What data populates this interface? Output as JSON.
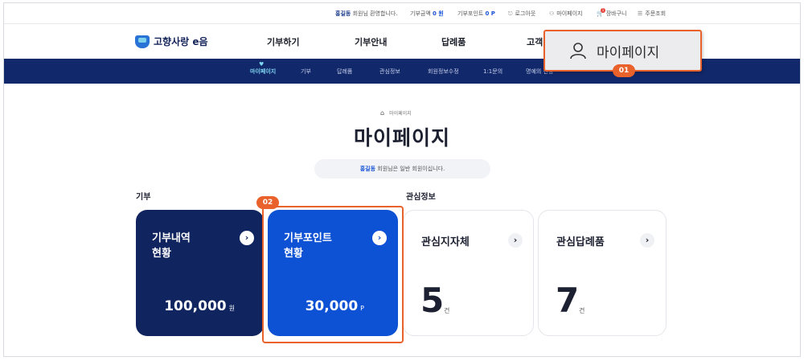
{
  "utility": {
    "user_name": "홍길동",
    "welcome": "회원님 환영합니다.",
    "donation_label": "기부금액",
    "donation_value": "0 원",
    "point_label": "기부포인트",
    "point_value": "0 P",
    "logout": "로그아웃",
    "mypage": "마이페이지",
    "cart": "장바구니",
    "cart_count": "1",
    "receipt": "주문조회"
  },
  "logo": {
    "text": "고향사랑 e음"
  },
  "gnb": {
    "items": [
      "기부하기",
      "기부안내",
      "답례품",
      "고객"
    ]
  },
  "subnav": {
    "items": [
      "마이페이지",
      "기부",
      "답례품",
      "관심정보",
      "회원정보수정",
      "1:1문의",
      "명예의 전당"
    ]
  },
  "breadcrumb": {
    "current": "마이페이지"
  },
  "page": {
    "title": "마이페이지",
    "grade_name": "홍길동",
    "grade_text": "회원님은 일반 회원이십니다."
  },
  "sections": {
    "donation": "기부",
    "interest": "관심정보"
  },
  "cards": {
    "donation": {
      "title_line1": "기부내역",
      "title_line2": "현황",
      "value": "100,000",
      "unit": "원"
    },
    "point": {
      "title_line1": "기부포인트",
      "title_line2": "현황",
      "value": "30,000",
      "unit": "P"
    },
    "region": {
      "title": "관심지자체",
      "value": "5",
      "unit": "건"
    },
    "gift": {
      "title": "관심답례품",
      "value": "7",
      "unit": "건"
    }
  },
  "annotations": {
    "badge1": "01",
    "badge2": "02",
    "callout_text": "마이페이지"
  },
  "colors": {
    "navy": "#102560",
    "blue": "#0d51d4",
    "accent": "#e9612b"
  }
}
